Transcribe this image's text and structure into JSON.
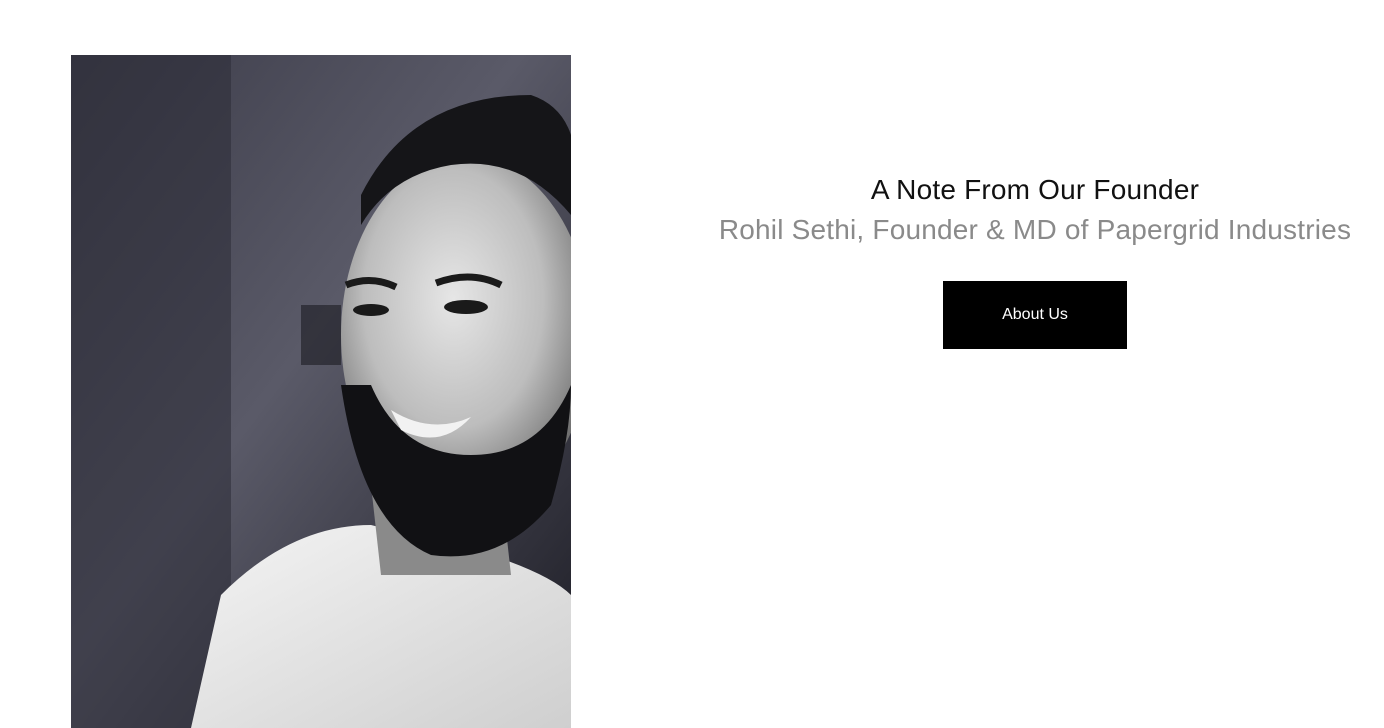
{
  "photo": {
    "alt": "Portrait of Rohil Sethi",
    "style": "black-and-white portrait photograph"
  },
  "note": {
    "title": "A Note From Our Founder",
    "subtitle": "Rohil Sethi, Founder & MD of Papergrid Industries",
    "button_label": "About Us"
  },
  "colors": {
    "background": "#ffffff",
    "title": "#111111",
    "subtitle": "#8a8a8a",
    "button_bg": "#000000",
    "button_text": "#ffffff"
  }
}
